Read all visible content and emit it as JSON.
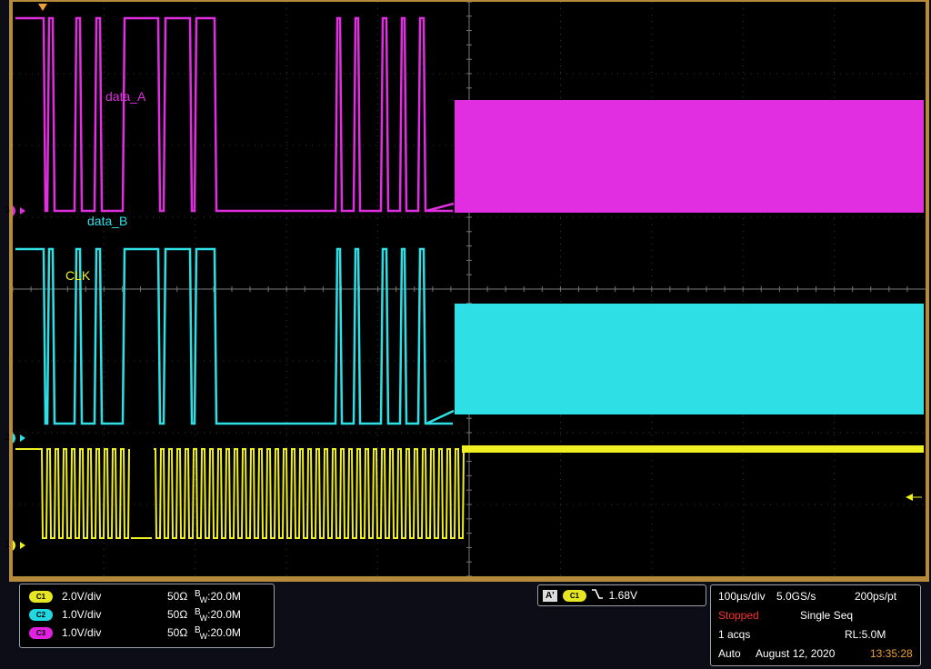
{
  "trace_labels": {
    "data_a": "data_A",
    "data_b": "data_B",
    "clk": "CLK"
  },
  "channel_markers": [
    "3",
    "2",
    "1"
  ],
  "colors": {
    "ch1": "#f0f020",
    "ch2": "#2ee0e6",
    "ch3": "#e02ee0",
    "frame": "#b58a3c",
    "stopped": "#ff3030",
    "time": "#f0a030"
  },
  "channels": [
    {
      "badge": "C1",
      "scale": "2.0V/div",
      "impedance": "50Ω",
      "bw_prefix": "B",
      "bw_sub": "W",
      "bw_value": ":20.0M"
    },
    {
      "badge": "C2",
      "scale": "1.0V/div",
      "impedance": "50Ω",
      "bw_prefix": "B",
      "bw_sub": "W",
      "bw_value": ":20.0M"
    },
    {
      "badge": "C3",
      "scale": "1.0V/div",
      "impedance": "50Ω",
      "bw_prefix": "B",
      "bw_sub": "W",
      "bw_value": ":20.0M"
    }
  ],
  "trigger": {
    "label": "A'",
    "source": "C1",
    "slope_icon": "falling-edge-icon",
    "level": "1.68V"
  },
  "acquisition": {
    "timebase": "100µs/div",
    "sample_rate": "5.0GS/s",
    "resolution": "200ps/pt",
    "status": "Stopped",
    "mode": "Single Seq",
    "acqs": "1 acqs",
    "record_length": "RL:5.0M",
    "trigger_mode": "Auto",
    "date": "August 12, 2020",
    "time": "13:35:28"
  }
}
